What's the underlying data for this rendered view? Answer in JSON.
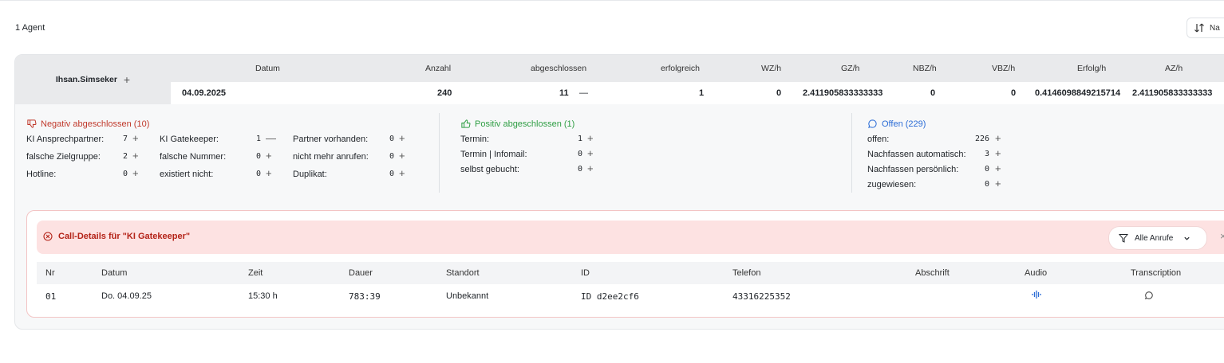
{
  "page": {
    "agent_count": "1 Agent",
    "sort_label": "Na"
  },
  "agent": {
    "name": "Ihsan.Simseker",
    "headers": {
      "datum": "Datum",
      "anzahl": "Anzahl",
      "abgeschlossen": "abgeschlossen",
      "erfolgreich": "erfolgreich",
      "wzh": "WZ/h",
      "gzh": "GZ/h",
      "nbzh": "NBZ/h",
      "vbzh": "VBZ/h",
      "erfolgh": "Erfolg/h",
      "azh": "AZ/h"
    },
    "values": {
      "datum": "04.09.2025",
      "anzahl": "240",
      "abgeschlossen": "11",
      "erfolgreich": "1",
      "wzh": "0",
      "gzh": "2.411905833333333",
      "nbzh": "0",
      "vbzh": "0",
      "erfolgh": "0.4146098849215714",
      "azh": "2.411905833333333"
    }
  },
  "negative": {
    "title": "Negativ abgeschlossen (10)",
    "items": [
      {
        "label": "KI Ansprechpartner:",
        "value": "7"
      },
      {
        "label": "falsche Zielgruppe:",
        "value": "2"
      },
      {
        "label": "Hotline:",
        "value": "0"
      },
      {
        "label": "KI Gatekeeper:",
        "value": "1"
      },
      {
        "label": "falsche Nummer:",
        "value": "0"
      },
      {
        "label": "existiert nicht:",
        "value": "0"
      },
      {
        "label": "Partner vorhanden:",
        "value": "0"
      },
      {
        "label": "nicht mehr anrufen:",
        "value": "0"
      },
      {
        "label": "Duplikat:",
        "value": "0"
      }
    ]
  },
  "positive": {
    "title": "Positiv abgeschlossen (1)",
    "items": [
      {
        "label": "Termin:",
        "value": "1"
      },
      {
        "label": "Termin | Infomail:",
        "value": "0"
      },
      {
        "label": "selbst gebucht:",
        "value": "0"
      }
    ]
  },
  "open": {
    "title": "Offen (229)",
    "items": [
      {
        "label": "offen:",
        "value": "226"
      },
      {
        "label": "Nachfassen automatisch:",
        "value": "3"
      },
      {
        "label": "Nachfassen persönlich:",
        "value": "0"
      },
      {
        "label": "zugewiesen:",
        "value": "0"
      }
    ]
  },
  "details": {
    "title": "Call-Details für \"KI Gatekeeper\"",
    "filter_label": "Alle Anrufe",
    "columns": [
      "Nr",
      "Datum",
      "Zeit",
      "Dauer",
      "Standort",
      "ID",
      "Telefon",
      "Abschrift",
      "Audio",
      "Transcription"
    ],
    "rows": [
      {
        "nr": "01",
        "datum": "Do. 04.09.25",
        "zeit": "15:30 h",
        "dauer": "783:39",
        "standort": "Unbekannt",
        "id": "ID d2ee2cf6",
        "telefon": "43316225352"
      }
    ]
  },
  "colors": {
    "negative": "#c0392b",
    "positive": "#2f9e44",
    "open": "#2b6cd6",
    "detail_header_bg": "#fde2e2"
  }
}
